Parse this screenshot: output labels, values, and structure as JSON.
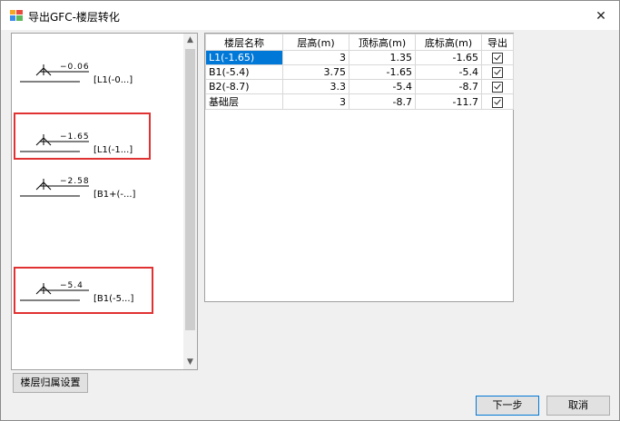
{
  "window": {
    "title": "导出GFC-楼层转化",
    "close_glyph": "✕"
  },
  "preview": {
    "items": [
      {
        "elev": "−0.06",
        "label": "[L1(-0...]",
        "highlighted": false
      },
      {
        "elev": "−1.65",
        "label": "[L1(-1...]",
        "highlighted": true
      },
      {
        "elev": "−2.58",
        "label": "[B1+(-...]",
        "highlighted": false
      },
      {
        "elev": "−5.4",
        "label": "[B1(-5...]",
        "highlighted": true
      }
    ]
  },
  "buttons": {
    "floor_setting": "楼层归属设置",
    "next": "下一步",
    "cancel": "取消"
  },
  "table": {
    "headers": [
      "楼层名称",
      "层高(m)",
      "顶标高(m)",
      "底标高(m)",
      "导出"
    ],
    "rows": [
      {
        "name": "L1(-1.65)",
        "height": "3",
        "top": "1.35",
        "bottom": "-1.65",
        "export": true,
        "selected": true
      },
      {
        "name": "B1(-5.4)",
        "height": "3.75",
        "top": "-1.65",
        "bottom": "-5.4",
        "export": true,
        "selected": false
      },
      {
        "name": "B2(-8.7)",
        "height": "3.3",
        "top": "-5.4",
        "bottom": "-8.7",
        "export": true,
        "selected": false
      },
      {
        "name": "基础层",
        "height": "3",
        "top": "-8.7",
        "bottom": "-11.7",
        "export": true,
        "selected": false
      }
    ]
  },
  "colors": {
    "selection": "#0078d7",
    "highlight_border": "#e03232"
  }
}
